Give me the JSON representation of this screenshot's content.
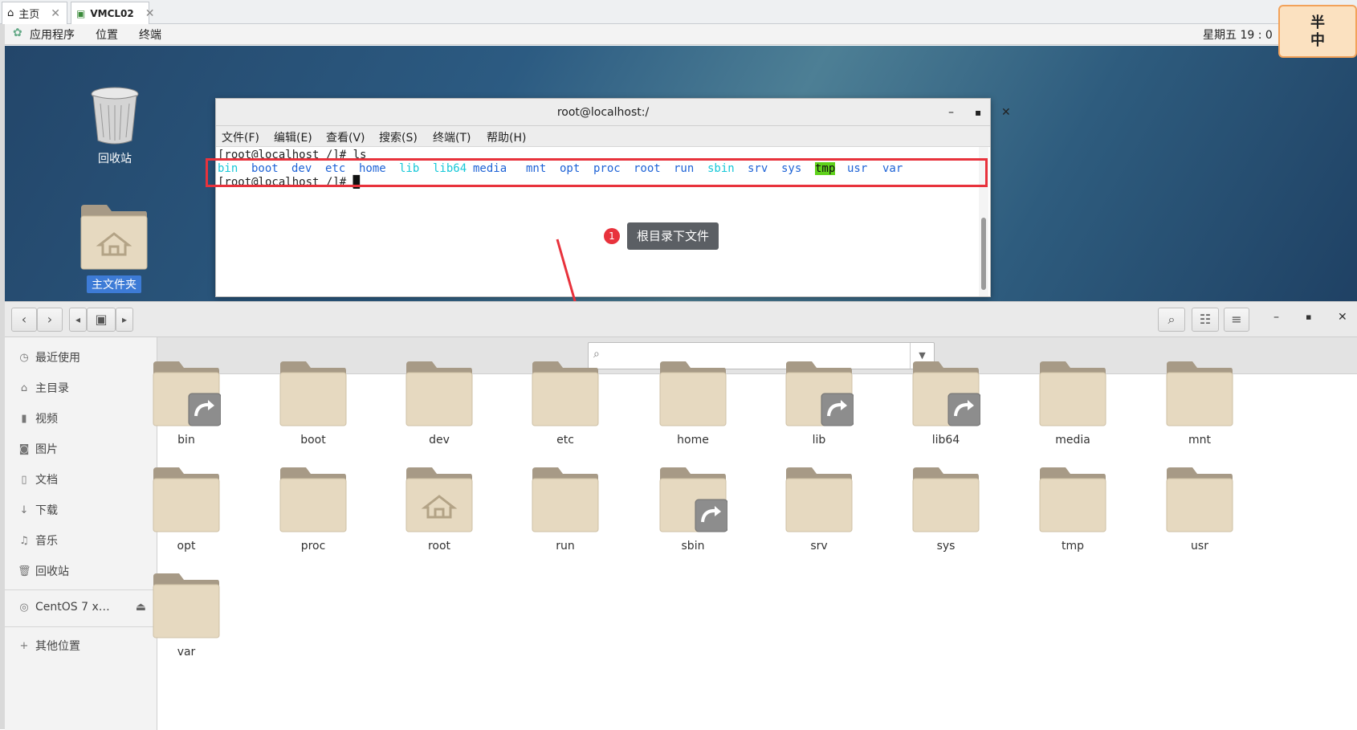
{
  "vm_tabs": [
    {
      "label": "主页",
      "icon": "home-icon"
    },
    {
      "label": "VMCL02",
      "icon": "vm-icon"
    }
  ],
  "topbar": {
    "apps": "应用程序",
    "places": "位置",
    "terminal": "终端",
    "clock": "星期五 19 : 0"
  },
  "desktop": {
    "trash_label": "回收站",
    "home_label": "主文件夹"
  },
  "terminal": {
    "title": "root@localhost:/",
    "menu": [
      "文件(F)",
      "编辑(E)",
      "查看(V)",
      "搜索(S)",
      "终端(T)",
      "帮助(H)"
    ],
    "line1": "[root@localhost /]# ls",
    "line3": "[root@localhost /]# ",
    "ls_output": [
      {
        "name": "bin",
        "type": "link"
      },
      {
        "name": "boot",
        "type": "dir"
      },
      {
        "name": "dev",
        "type": "dir"
      },
      {
        "name": "etc",
        "type": "dir"
      },
      {
        "name": "home",
        "type": "dir"
      },
      {
        "name": "lib",
        "type": "link"
      },
      {
        "name": "lib64",
        "type": "link"
      },
      {
        "name": "media",
        "type": "dir"
      },
      {
        "name": "mnt",
        "type": "dir"
      },
      {
        "name": "opt",
        "type": "dir"
      },
      {
        "name": "proc",
        "type": "dir"
      },
      {
        "name": "root",
        "type": "dir"
      },
      {
        "name": "run",
        "type": "dir"
      },
      {
        "name": "sbin",
        "type": "link"
      },
      {
        "name": "srv",
        "type": "dir"
      },
      {
        "name": "sys",
        "type": "dir"
      },
      {
        "name": "tmp",
        "type": "sticky"
      },
      {
        "name": "usr",
        "type": "dir"
      },
      {
        "name": "var",
        "type": "dir"
      }
    ]
  },
  "annotation": {
    "number": "1",
    "text": "根目录下文件"
  },
  "sidebar": {
    "items": [
      {
        "label": "最近使用",
        "icon": "clock-icon"
      },
      {
        "label": "主目录",
        "icon": "home-icon"
      },
      {
        "label": "视频",
        "icon": "video-icon"
      },
      {
        "label": "图片",
        "icon": "camera-icon"
      },
      {
        "label": "文档",
        "icon": "document-icon"
      },
      {
        "label": "下载",
        "icon": "download-icon"
      },
      {
        "label": "音乐",
        "icon": "music-icon"
      },
      {
        "label": "回收站",
        "icon": "trash-icon"
      }
    ],
    "device": "CentOS 7 x…",
    "other": "其他位置"
  },
  "folders": [
    {
      "name": "bin",
      "badge": "link"
    },
    {
      "name": "boot",
      "badge": ""
    },
    {
      "name": "dev",
      "badge": ""
    },
    {
      "name": "etc",
      "badge": ""
    },
    {
      "name": "home",
      "badge": ""
    },
    {
      "name": "lib",
      "badge": "link"
    },
    {
      "name": "lib64",
      "badge": "link"
    },
    {
      "name": "media",
      "badge": ""
    },
    {
      "name": "mnt",
      "badge": ""
    },
    {
      "name": "opt",
      "badge": ""
    },
    {
      "name": "proc",
      "badge": ""
    },
    {
      "name": "root",
      "badge": "home"
    },
    {
      "name": "run",
      "badge": ""
    },
    {
      "name": "sbin",
      "badge": "link"
    },
    {
      "name": "srv",
      "badge": ""
    },
    {
      "name": "sys",
      "badge": ""
    },
    {
      "name": "tmp",
      "badge": ""
    },
    {
      "name": "usr",
      "badge": ""
    },
    {
      "name": "var",
      "badge": ""
    }
  ],
  "badge": {
    "line1": "半",
    "line2": "中"
  },
  "colors": {
    "dir": "#1e63d6",
    "link": "#16c8d8",
    "sticky_bg": "#5fd11b",
    "highlight": "#e8323c"
  }
}
